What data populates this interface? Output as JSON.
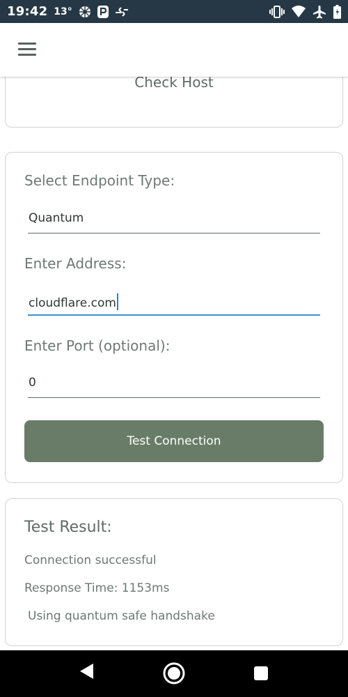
{
  "status_bar": {
    "time": "19:42",
    "temperature": "13°",
    "left_icons": [
      "aperture-icon",
      "parking-icon",
      "transfer-icon"
    ],
    "right_icons": [
      "vibrate-icon",
      "wifi-icon",
      "airplane-icon",
      "battery-icon"
    ]
  },
  "app_bar": {
    "menu_icon": "hamburger-menu-icon"
  },
  "host_card": {
    "label": "Check Host"
  },
  "form": {
    "endpoint_label": "Select Endpoint Type:",
    "endpoint_value": "Quantum",
    "address_label": "Enter Address:",
    "address_value": "cloudflare.com",
    "port_label": "Enter Port (optional):",
    "port_value": "0",
    "test_button": "Test Connection"
  },
  "result": {
    "title": "Test Result:",
    "status": "Connection successful",
    "response_time": "Response Time: 1153ms",
    "handshake": "Using quantum safe handshake"
  },
  "navigation": {
    "back_icon": "back-triangle-icon",
    "home_icon": "home-circle-icon",
    "recents_icon": "recents-square-icon"
  },
  "colors": {
    "status_bar": "#263846",
    "button": "#687c68",
    "focus_underline": "#3d8fd1",
    "text": "#5f6a66"
  }
}
